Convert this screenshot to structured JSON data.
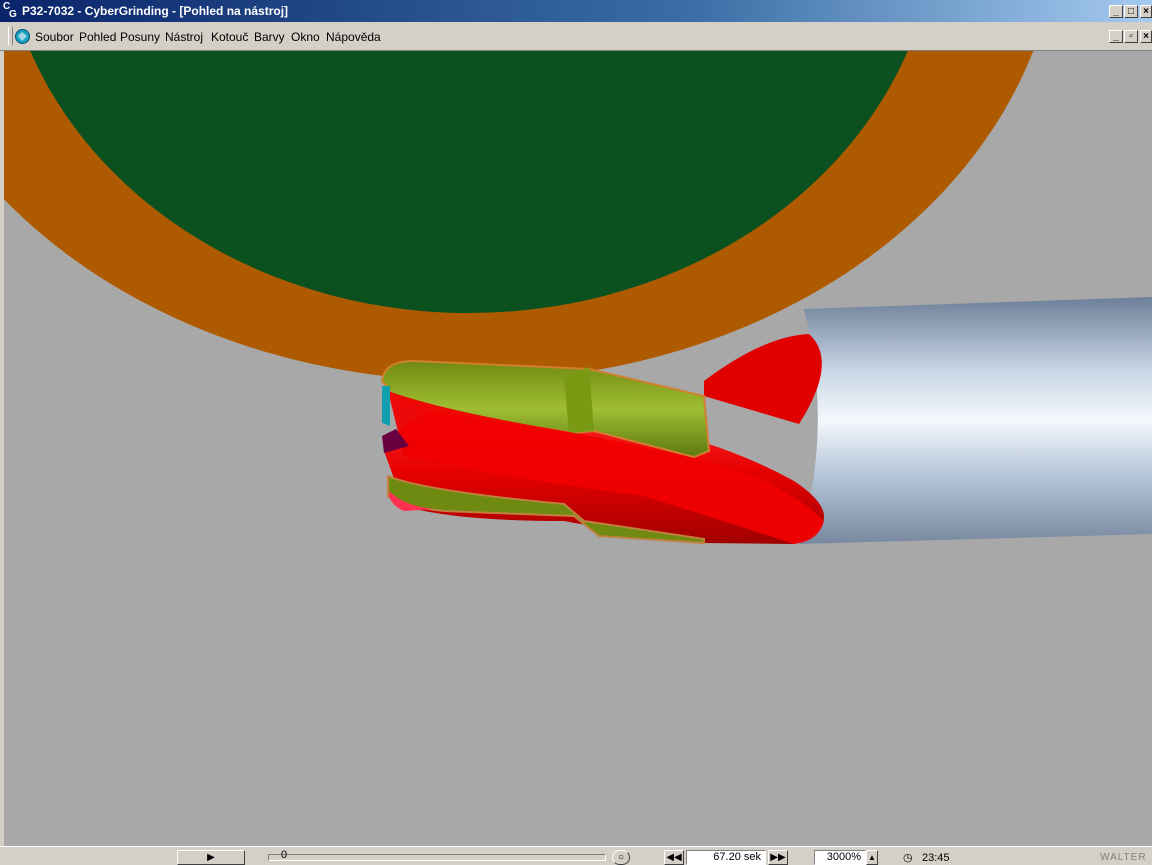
{
  "window": {
    "title": "P32-7032 - CyberGrinding - [Pohled na nástroj]",
    "app_icon": "CG"
  },
  "menu": {
    "items": [
      {
        "label": "Soubor"
      },
      {
        "label": "Pohled"
      },
      {
        "label": "Posuny"
      },
      {
        "label": "Nástroj"
      },
      {
        "label": "Kotouč"
      },
      {
        "label": "Barvy"
      },
      {
        "label": "Okno"
      },
      {
        "label": "Nápověda"
      }
    ]
  },
  "status": {
    "slider_value": "0",
    "time_field": "67.20 sek",
    "zoom_field": "3000%",
    "clock": "23:45",
    "logo": "WALTER"
  },
  "colors": {
    "wheel_center": "#0b5120",
    "wheel_ring": "#ae5a00",
    "viewport_bg": "#a8a8a8",
    "tool_red": "#e80000",
    "flute_green": "#7e9a16",
    "shank": "#b8c8dc"
  }
}
